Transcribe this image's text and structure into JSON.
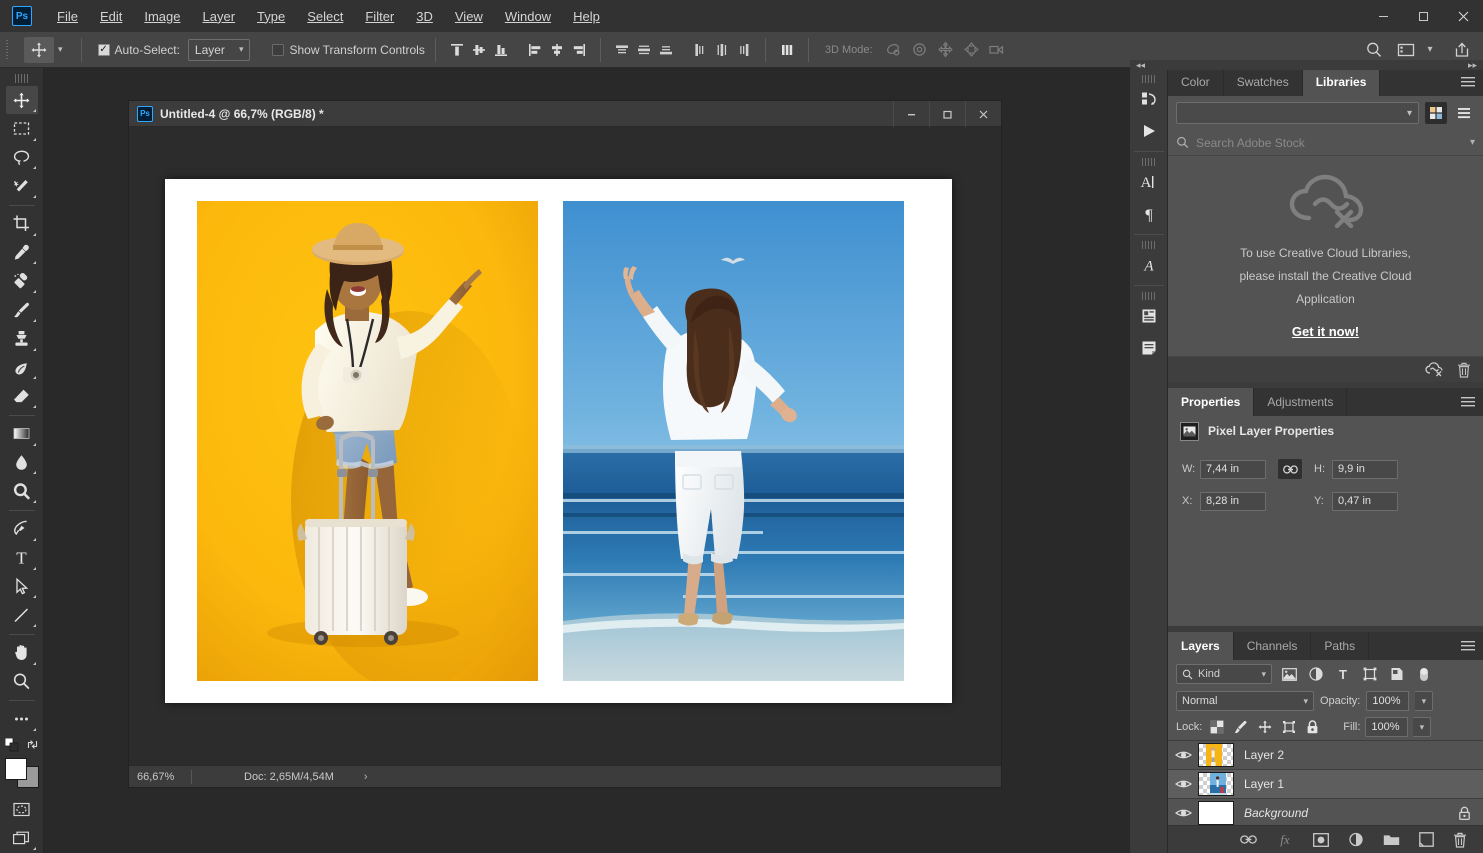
{
  "app": {
    "logo": "Ps",
    "menu": [
      "File",
      "Edit",
      "Image",
      "Layer",
      "Type",
      "Select",
      "Filter",
      "3D",
      "View",
      "Window",
      "Help"
    ],
    "window_controls": [
      "minimize",
      "maximize",
      "close"
    ]
  },
  "options_bar": {
    "tool_icon": "move-tool-icon",
    "auto_select_label": "Auto-Select:",
    "auto_select_checked": true,
    "auto_select_value": "Layer",
    "show_transform_label": "Show Transform Controls",
    "show_transform_checked": false,
    "align_group": [
      "align-top-edges",
      "align-vertical-centers",
      "align-bottom-edges"
    ],
    "align_group2": [
      "align-left-edges",
      "align-horizontal-centers",
      "align-right-edges"
    ],
    "distribute_group": [
      "distribute-top-edges",
      "distribute-vertical-centers",
      "distribute-bottom-edges"
    ],
    "distribute_group2": [
      "distribute-left-edges",
      "distribute-horizontal-centers",
      "distribute-right-edges"
    ],
    "extra_align": "align-and-distribute",
    "mode3d_label": "3D Mode:",
    "mode3d_icons": [
      "orbit-3d",
      "roll-3d",
      "pan-3d",
      "slide-3d",
      "camera-3d"
    ],
    "right_icons": [
      "search-icon",
      "workspace-icon",
      "chevron-down-icon",
      "share-icon"
    ]
  },
  "toolbar": {
    "tools": [
      {
        "name": "move-tool",
        "active": true
      },
      {
        "name": "rectangular-marquee-tool",
        "active": false
      },
      {
        "name": "lasso-tool",
        "active": false
      },
      {
        "name": "magic-wand-tool",
        "active": false
      },
      {
        "name": "crop-tool",
        "active": false
      },
      {
        "name": "eyedropper-tool",
        "active": false
      },
      {
        "name": "spot-healing-brush-tool",
        "active": false
      },
      {
        "name": "brush-tool",
        "active": false
      },
      {
        "name": "clone-stamp-tool",
        "active": false
      },
      {
        "name": "history-brush-tool",
        "active": false
      },
      {
        "name": "eraser-tool",
        "active": false
      },
      {
        "name": "gradient-tool",
        "active": false
      },
      {
        "name": "blur-tool",
        "active": false
      },
      {
        "name": "dodge-tool",
        "active": false
      },
      {
        "name": "pen-tool",
        "active": false
      },
      {
        "name": "horizontal-type-tool",
        "active": false
      },
      {
        "name": "path-selection-tool",
        "active": false
      },
      {
        "name": "line-tool",
        "active": false
      },
      {
        "name": "hand-tool",
        "active": false
      },
      {
        "name": "zoom-tool",
        "active": false
      },
      {
        "name": "edit-toolbar-tool",
        "active": false
      }
    ],
    "foreground_color": "#ffffff",
    "background_color": "#9a9a9a",
    "quick_mask": "quick-mask-mode-icon",
    "screen_mode": "screen-mode-icon"
  },
  "document": {
    "logo": "Ps",
    "title": "Untitled-4 @ 66,7% (RGB/8) *",
    "window_controls": [
      "minimize",
      "maximize",
      "close"
    ],
    "status": {
      "zoom": "66,67%",
      "doc": "Doc: 2,65M/4,54M",
      "arrow": "›"
    },
    "photos": [
      {
        "name": "photo-woman-yellow-background",
        "alt": "Woman in straw hat pointing with white suitcase on yellow background"
      },
      {
        "name": "photo-woman-beach",
        "alt": "Woman with arm raised and red suitcase at the beach"
      }
    ]
  },
  "rail": {
    "icons": [
      "history-panel-icon",
      "actions-panel-icon",
      "character-panel-icon",
      "paragraph-panel-icon",
      "glyphs-panel-icon",
      "layer-comps-panel-icon",
      "notes-panel-icon"
    ]
  },
  "libraries": {
    "tabs": [
      {
        "label": "Color",
        "active": false
      },
      {
        "label": "Swatches",
        "active": false
      },
      {
        "label": "Libraries",
        "active": true
      }
    ],
    "menu_icon": "panel-menu-icon",
    "library_select_value": "",
    "view_grid_icon": "grid-view-icon",
    "view_list_icon": "list-view-icon",
    "search_placeholder": "Search Adobe Stock",
    "search_value": "",
    "empty_icon": "cloud-disconnected-icon",
    "empty_message_line1": "To use Creative Cloud Libraries,",
    "empty_message_line2": "please install the Creative Cloud",
    "empty_message_line3": "Application",
    "cta_label": "Get it now!",
    "footer_icons": [
      "sync-disabled-icon",
      "trash-icon"
    ]
  },
  "properties": {
    "tabs": [
      {
        "label": "Properties",
        "active": true
      },
      {
        "label": "Adjustments",
        "active": false
      }
    ],
    "menu_icon": "panel-menu-icon",
    "header_icon": "pixel-layer-icon",
    "header_title": "Pixel Layer Properties",
    "fields": [
      {
        "label": "W:",
        "value": "7,44 in",
        "name": "width-field"
      },
      {
        "label": "H:",
        "value": "9,9 in",
        "name": "height-field"
      },
      {
        "label": "X:",
        "value": "8,28 in",
        "name": "x-position-field"
      },
      {
        "label": "Y:",
        "value": "0,47 in",
        "name": "y-position-field"
      }
    ],
    "link_icon": "link-dimensions-icon"
  },
  "layers": {
    "tabs": [
      {
        "label": "Layers",
        "active": true
      },
      {
        "label": "Channels",
        "active": false
      },
      {
        "label": "Paths",
        "active": false
      }
    ],
    "menu_icon": "panel-menu-icon",
    "filter_label": "Kind",
    "filter_icons": [
      "filter-pixel-icon",
      "filter-adjustment-icon",
      "filter-type-icon",
      "filter-shape-icon",
      "filter-smart-object-icon",
      "filter-toggle-icon"
    ],
    "blend_mode": "Normal",
    "opacity_label": "Opacity:",
    "opacity_value": "100%",
    "lock_label": "Lock:",
    "lock_icons": [
      "lock-transparent-pixels-icon",
      "lock-image-pixels-icon",
      "lock-position-icon",
      "lock-artboard-icon",
      "lock-all-icon"
    ],
    "fill_label": "Fill:",
    "fill_value": "100%",
    "rows": [
      {
        "name": "Layer 2",
        "visible": true,
        "locked": false,
        "italic": false,
        "thumb": "yellow",
        "selected": false
      },
      {
        "name": "Layer 1",
        "visible": true,
        "locked": false,
        "italic": false,
        "thumb": "beach",
        "selected": true
      },
      {
        "name": "Background",
        "visible": true,
        "locked": true,
        "italic": true,
        "thumb": "white",
        "selected": false
      }
    ],
    "footer_icons": [
      "link-layers-icon",
      "layer-style-fx-icon",
      "add-layer-mask-icon",
      "new-adjustment-layer-icon",
      "new-group-icon",
      "new-layer-icon",
      "delete-layer-icon"
    ]
  }
}
